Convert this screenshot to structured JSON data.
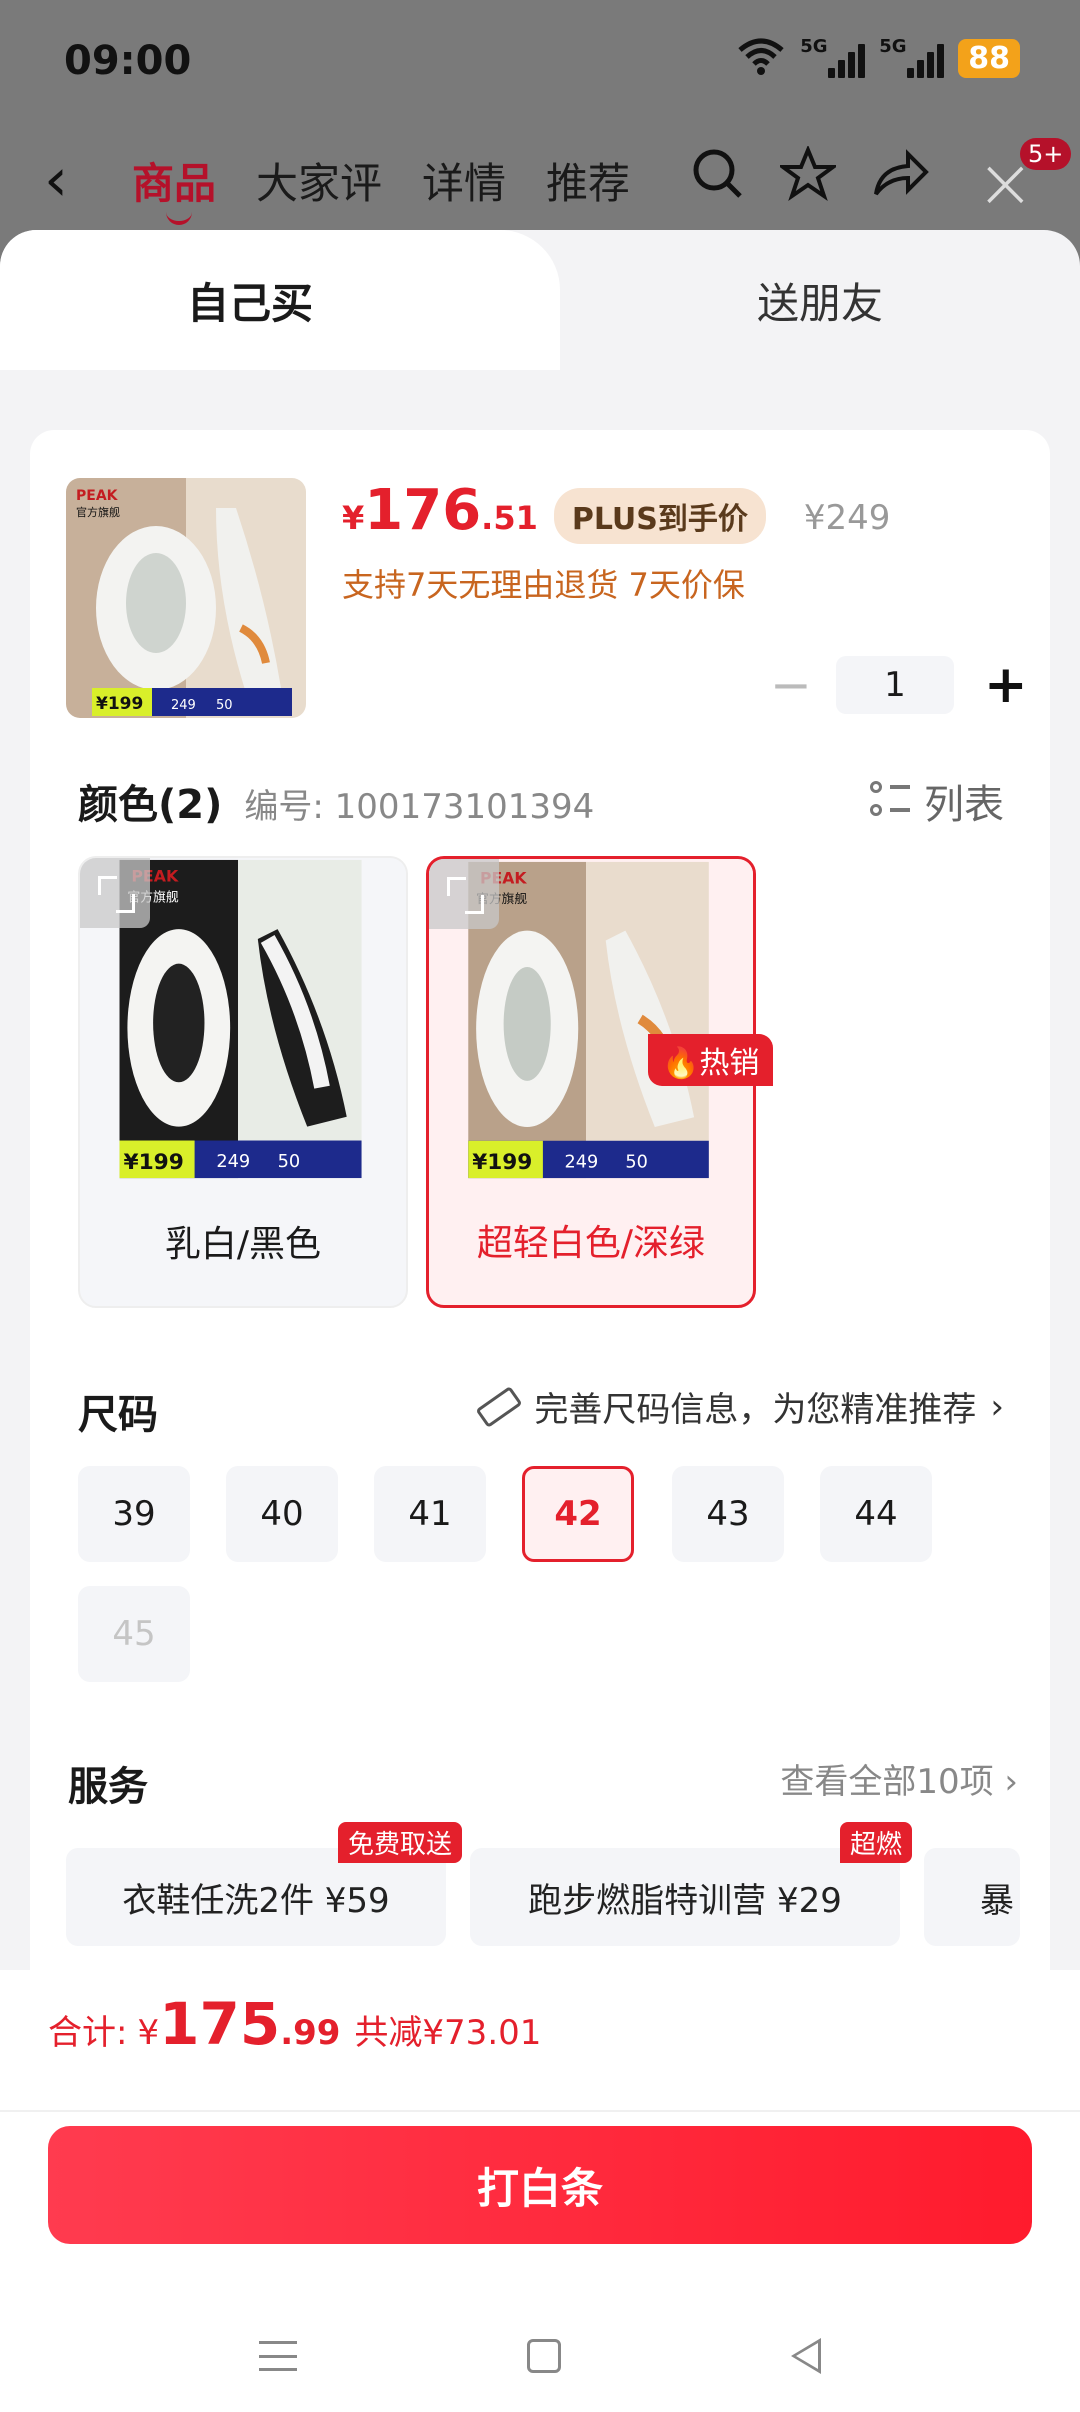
{
  "status": {
    "time": "09:00",
    "signal1": "5G",
    "signal2": "5G",
    "battery": "88"
  },
  "nav": {
    "back_icon": "back-chevron-icon",
    "tabs": [
      "商品",
      "大家评",
      "详情",
      "推荐"
    ],
    "badge": "5+"
  },
  "sheet": {
    "tab_self": "自己买",
    "tab_gift": "送朋友",
    "product": {
      "price_yen": "¥",
      "price_int": "176",
      "price_dec": ".51",
      "plus_badge": "PLUS到手价",
      "original": "¥249",
      "support": "支持7天无理由退货  7天价保",
      "qty_minus": "−",
      "qty": "1",
      "qty_plus": "+",
      "thumb": {
        "logo": "PEAK",
        "store": "官方旗舰",
        "promo_price": "¥199",
        "promo_2": "249",
        "promo_3": "50"
      }
    },
    "color": {
      "title": "颜色(2)",
      "sku": "编号: 100173101394",
      "list_btn": "列表",
      "hot_tag": "热销",
      "options": [
        {
          "label": "乳白/黑色",
          "promo_price": "¥199",
          "promo_2": "249",
          "promo_3": "50",
          "logo": "PEAK",
          "store": "官方旗舰",
          "palette": [
            "#1c1c1c",
            "#e8ece6"
          ]
        },
        {
          "label": "超轻白色/深绿",
          "promo_price": "¥199",
          "promo_2": "249",
          "promo_3": "50",
          "logo": "PEAK",
          "store": "官方旗舰",
          "palette": [
            "#b9a18a",
            "#e9dccd"
          ]
        }
      ]
    },
    "size": {
      "title": "尺码",
      "hint": "完善尺码信息，为您精准推荐",
      "chevron": "›",
      "sizes": [
        "39",
        "40",
        "41",
        "42",
        "43",
        "44",
        "45"
      ],
      "selected": "42",
      "disabled": "45"
    },
    "service": {
      "title": "服务",
      "all": "查看全部10项  ›",
      "items": [
        {
          "label": "衣鞋任洗2件  ¥59",
          "tag": "免费取送"
        },
        {
          "label": "跑步燃脂特训营  ¥29",
          "tag": "超燃"
        },
        {
          "label": "暴",
          "tag": ""
        }
      ]
    },
    "total": {
      "label": "合计:",
      "yen": "¥",
      "int": "175",
      "dec": ".99",
      "cut": "共减¥73.01"
    },
    "buy_button": "打白条"
  },
  "colors": {
    "accent": "#e4202c",
    "plus": "#f7e3d1",
    "support_text": "#c8651f"
  }
}
